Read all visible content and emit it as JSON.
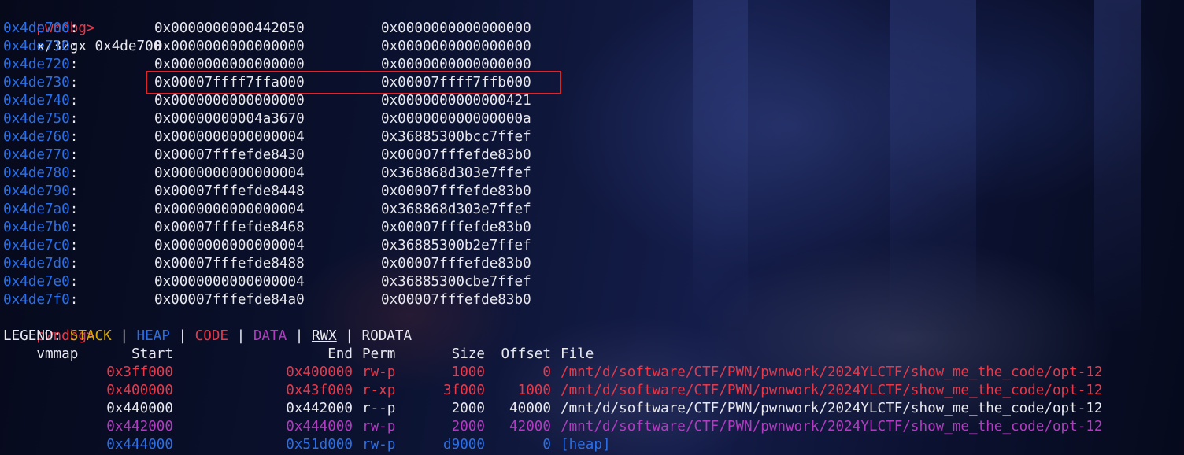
{
  "prompt": "pwndbg>",
  "command1": "x/32gx 0x4de700",
  "memory_rows": [
    {
      "addr": "0x4de700",
      "v1": "0x0000000000442050",
      "v2": "0x0000000000000000"
    },
    {
      "addr": "0x4de710",
      "v1": "0x0000000000000000",
      "v2": "0x0000000000000000"
    },
    {
      "addr": "0x4de720",
      "v1": "0x0000000000000000",
      "v2": "0x0000000000000000"
    },
    {
      "addr": "0x4de730",
      "v1": "0x00007ffff7ffa000",
      "v2": "0x00007ffff7ffb000"
    },
    {
      "addr": "0x4de740",
      "v1": "0x0000000000000000",
      "v2": "0x0000000000000421"
    },
    {
      "addr": "0x4de750",
      "v1": "0x00000000004a3670",
      "v2": "0x000000000000000a"
    },
    {
      "addr": "0x4de760",
      "v1": "0x0000000000000004",
      "v2": "0x36885300bcc7ffef"
    },
    {
      "addr": "0x4de770",
      "v1": "0x00007fffefde8430",
      "v2": "0x00007fffefde83b0"
    },
    {
      "addr": "0x4de780",
      "v1": "0x0000000000000004",
      "v2": "0x368868d303e7ffef"
    },
    {
      "addr": "0x4de790",
      "v1": "0x00007fffefde8448",
      "v2": "0x00007fffefde83b0"
    },
    {
      "addr": "0x4de7a0",
      "v1": "0x0000000000000004",
      "v2": "0x368868d303e7ffef"
    },
    {
      "addr": "0x4de7b0",
      "v1": "0x00007fffefde8468",
      "v2": "0x00007fffefde83b0"
    },
    {
      "addr": "0x4de7c0",
      "v1": "0x0000000000000004",
      "v2": "0x36885300b2e7ffef"
    },
    {
      "addr": "0x4de7d0",
      "v1": "0x00007fffefde8488",
      "v2": "0x00007fffefde83b0"
    },
    {
      "addr": "0x4de7e0",
      "v1": "0x0000000000000004",
      "v2": "0x36885300cbe7ffef"
    },
    {
      "addr": "0x4de7f0",
      "v1": "0x00007fffefde84a0",
      "v2": "0x00007fffefde83b0"
    }
  ],
  "highlighted_row_addr": "0x4de730",
  "command2": "vmmap",
  "legend": {
    "label": "LEGEND:",
    "stack": "STACK",
    "heap": "HEAP",
    "code": "CODE",
    "data": "DATA",
    "rwx": "RWX",
    "rodata": "RODATA",
    "sep": "|"
  },
  "vmmap_header": {
    "start": "Start",
    "end": "End",
    "perm": "Perm",
    "size": "Size",
    "offset": "Offset",
    "file": "File"
  },
  "vmmap_rows": [
    {
      "kind": "code",
      "start": "0x3ff000",
      "end": "0x400000",
      "perm": "rw-p",
      "size": "1000",
      "offset": "0",
      "file": "/mnt/d/software/CTF/PWN/pwnwork/2024YLCTF/show_me_the_code/opt-12"
    },
    {
      "kind": "code",
      "start": "0x400000",
      "end": "0x43f000",
      "perm": "r-xp",
      "size": "3f000",
      "offset": "1000",
      "file": "/mnt/d/software/CTF/PWN/pwnwork/2024YLCTF/show_me_the_code/opt-12"
    },
    {
      "kind": "ro",
      "start": "0x440000",
      "end": "0x442000",
      "perm": "r--p",
      "size": "2000",
      "offset": "40000",
      "file": "/mnt/d/software/CTF/PWN/pwnwork/2024YLCTF/show_me_the_code/opt-12"
    },
    {
      "kind": "data",
      "start": "0x442000",
      "end": "0x444000",
      "perm": "rw-p",
      "size": "2000",
      "offset": "42000",
      "file": "/mnt/d/software/CTF/PWN/pwnwork/2024YLCTF/show_me_the_code/opt-12"
    },
    {
      "kind": "heap",
      "start": "0x444000",
      "end": "0x51d000",
      "perm": "rw-p",
      "size": "d9000",
      "offset": "0",
      "file": "[heap]"
    }
  ],
  "colors": {
    "prompt": "#e8394a",
    "address": "#2b6fe6",
    "text": "#e8e8ee",
    "highlight_border": "#e0242a",
    "stack": "#d8a900",
    "heap": "#2b6fe6",
    "code": "#e8394a",
    "data": "#b23cc0"
  }
}
